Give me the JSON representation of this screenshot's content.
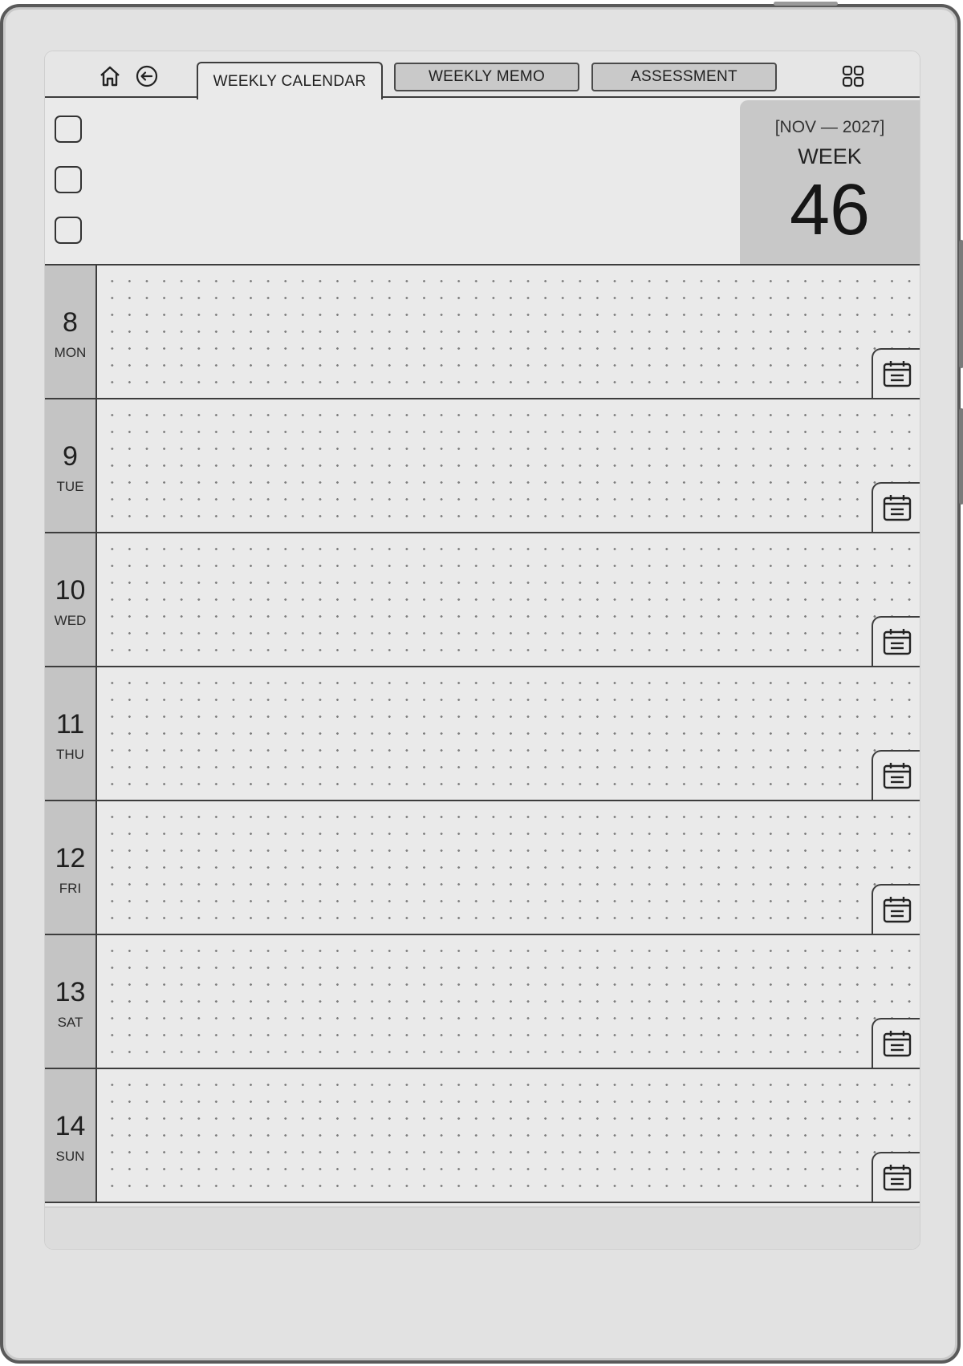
{
  "nav": {
    "home_icon": "home-icon",
    "back_icon": "back-arrow-icon",
    "tabs": [
      {
        "label": "WEEKLY CALENDAR",
        "active": true
      },
      {
        "label": "WEEKLY MEMO",
        "active": false
      },
      {
        "label": "ASSESSMENT",
        "active": false
      }
    ],
    "grid_icon": "grid-menu-icon"
  },
  "header": {
    "month": "[NOV — 2027]",
    "week_label": "WEEK",
    "week_number": "46"
  },
  "days": [
    {
      "num": "8",
      "name": "MON"
    },
    {
      "num": "9",
      "name": "TUE"
    },
    {
      "num": "10",
      "name": "WED"
    },
    {
      "num": "11",
      "name": "THU"
    },
    {
      "num": "12",
      "name": "FRI"
    },
    {
      "num": "13",
      "name": "SAT"
    },
    {
      "num": "14",
      "name": "SUN"
    }
  ],
  "colors": {
    "screen_bg": "#eaeaea",
    "accent_gray": "#c4c4c4",
    "line": "#3d3d3d"
  }
}
